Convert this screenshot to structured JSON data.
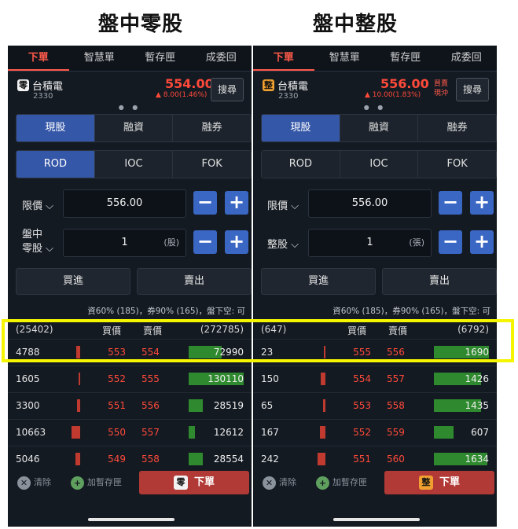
{
  "left": {
    "heading": "盤中零股",
    "tabs": [
      "下單",
      "智慧單",
      "暫存匣",
      "成委回"
    ],
    "stock": {
      "badge": "零",
      "name": "台積電",
      "code": "2330",
      "price": "554.00",
      "change": "▲ 8.00(1.46%)",
      "extra": "",
      "search": "搜尋"
    },
    "type_tabs": [
      "現股",
      "融資",
      "融券"
    ],
    "tif_tabs": [
      "ROD",
      "IOC",
      "FOK"
    ],
    "price_label": "限價 ⌵",
    "price_value": "556.00",
    "qty_label_1": "盤中",
    "qty_label_2": "零股 ⌵",
    "qty_value": "1",
    "qty_unit": "(股)",
    "buy": "買進",
    "sell": "賣出",
    "info": "資60% (185)，券90% (165)，盤下空: 可",
    "book_head": {
      "bid_total": "(25402)",
      "bid": "買價",
      "ask": "賣價",
      "ask_total": "(272785)"
    },
    "book": [
      {
        "bq": "4788",
        "bp": "553",
        "ap": "554",
        "aq": "72990",
        "bidlvl": 0.2,
        "asklvl": 0.6
      },
      {
        "bq": "1605",
        "bp": "552",
        "ap": "555",
        "aq": "130110",
        "bidlvl": 0.1,
        "asklvl": 1.0
      },
      {
        "bq": "3300",
        "bp": "551",
        "ap": "556",
        "aq": "28519",
        "bidlvl": 0.15,
        "asklvl": 0.25
      },
      {
        "bq": "10663",
        "bp": "550",
        "ap": "557",
        "aq": "12612",
        "bidlvl": 0.45,
        "asklvl": 0.12
      },
      {
        "bq": "5046",
        "bp": "549",
        "ap": "558",
        "aq": "28554",
        "bidlvl": 0.25,
        "asklvl": 0.25
      }
    ],
    "bottom": {
      "clear": "清除",
      "add": "加暫存匣",
      "order": "下單",
      "order_badge": "零"
    }
  },
  "right": {
    "heading": "盤中整股",
    "tabs": [
      "下單",
      "智慧單",
      "暫存匣",
      "成委回"
    ],
    "stock": {
      "badge": "整",
      "name": "台積電",
      "code": "2330",
      "price": "556.00",
      "change": "▲ 10.00(1.83%)",
      "extra": "買賣 現沖",
      "search": "搜尋"
    },
    "type_tabs": [
      "現股",
      "融資",
      "融券"
    ],
    "tif_tabs": [
      "ROD",
      "IOC",
      "FOK"
    ],
    "price_label": "限價 ⌵",
    "price_value": "556.00",
    "qty_label_1": "整股 ⌵",
    "qty_label_2": "",
    "qty_value": "1",
    "qty_unit": "(張)",
    "buy": "買進",
    "sell": "賣出",
    "info": "資60% (185)，券90% (165)，盤下空: 可",
    "book_head": {
      "bid_total": "(647)",
      "bid": "買價",
      "ask": "賣價",
      "ask_total": "(6792)"
    },
    "book": [
      {
        "bq": "23",
        "bp": "555",
        "ap": "556",
        "aq": "1690",
        "bidlvl": 0.05,
        "asklvl": 1.0
      },
      {
        "bq": "150",
        "bp": "554",
        "ap": "557",
        "aq": "1426",
        "bidlvl": 0.25,
        "asklvl": 0.85
      },
      {
        "bq": "65",
        "bp": "553",
        "ap": "558",
        "aq": "1435",
        "bidlvl": 0.12,
        "asklvl": 0.85
      },
      {
        "bq": "167",
        "bp": "552",
        "ap": "559",
        "aq": "607",
        "bidlvl": 0.28,
        "asklvl": 0.36
      },
      {
        "bq": "242",
        "bp": "551",
        "ap": "560",
        "aq": "1634",
        "bidlvl": 0.4,
        "asklvl": 0.97
      }
    ],
    "bottom": {
      "clear": "清除",
      "add": "加暫存匣",
      "order": "下單",
      "order_badge": "整"
    }
  }
}
